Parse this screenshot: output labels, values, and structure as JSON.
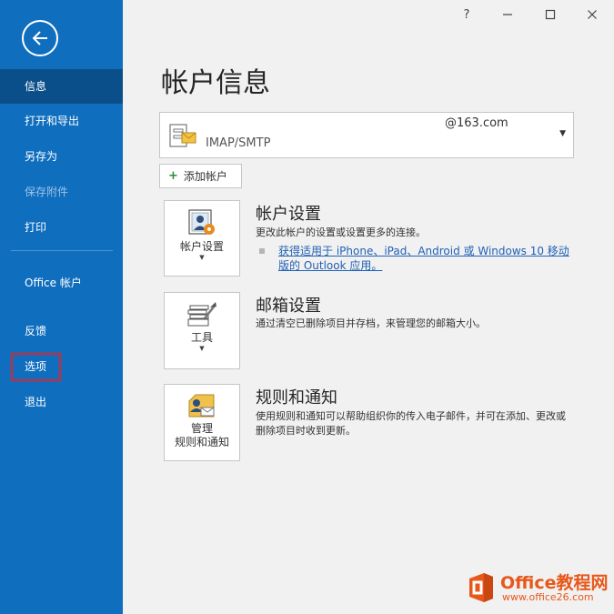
{
  "window": {
    "help_label": "?",
    "minimize_label": "—",
    "maximize_label": "☐",
    "close_label": "✕"
  },
  "sidebar": {
    "back_icon": "back-arrow-icon",
    "items": [
      {
        "label": "信息",
        "active": true,
        "disabled": false
      },
      {
        "label": "打开和导出",
        "active": false,
        "disabled": false
      },
      {
        "label": "另存为",
        "active": false,
        "disabled": false
      },
      {
        "label": "保存附件",
        "active": false,
        "disabled": true
      },
      {
        "label": "打印",
        "active": false,
        "disabled": false
      },
      {
        "label": "Office 帐户",
        "active": false,
        "disabled": false
      },
      {
        "label": "反馈",
        "active": false,
        "disabled": false
      },
      {
        "label": "选项",
        "active": false,
        "disabled": false,
        "highlighted": true
      },
      {
        "label": "退出",
        "active": false,
        "disabled": false
      }
    ]
  },
  "main": {
    "title": "帐户信息",
    "account": {
      "email": "@163.com",
      "type": "IMAP/SMTP"
    },
    "add_account_label": "添加帐户",
    "sections": [
      {
        "tile_label": "帐户设置",
        "heading": "帐户设置",
        "description": "更改此帐户的设置或设置更多的连接。",
        "link": "获得适用于 iPhone、iPad、Android 或 Windows 10 移动版的 Outlook 应用。"
      },
      {
        "tile_label": "工具",
        "heading": "邮箱设置",
        "description": "通过清空已删除项目并存档，来管理您的邮箱大小。"
      },
      {
        "tile_label_line1": "管理",
        "tile_label_line2": "规则和通知",
        "heading": "规则和通知",
        "description": "使用规则和通知可以帮助组织你的传入电子邮件，并可在添加、更改或删除项目时收到更新。"
      }
    ]
  },
  "watermark": {
    "name": "Office教程网",
    "url": "www.office26.com"
  },
  "colors": {
    "sidebar_bg": "#106ebe",
    "sidebar_active": "#0b4f8a",
    "highlight_border": "#e0242b",
    "link": "#2161b5",
    "watermark": "#e8581a"
  }
}
